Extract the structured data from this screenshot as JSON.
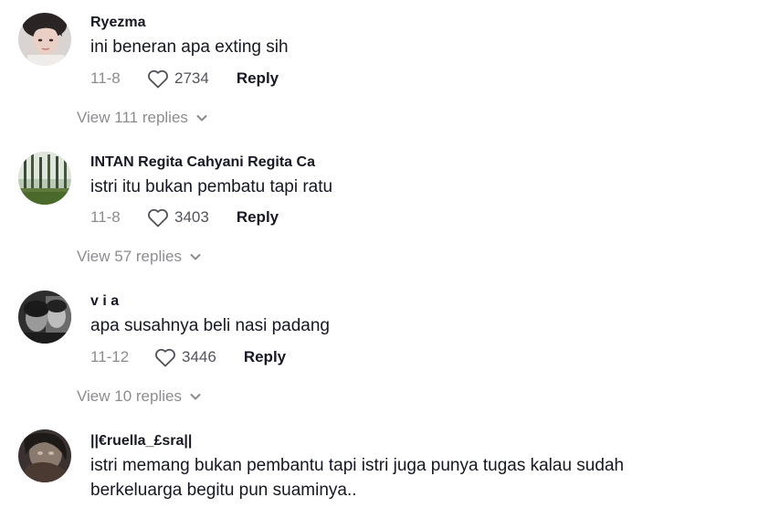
{
  "comments": [
    {
      "username": "Ryezma",
      "text": "ini beneran apa exting sih",
      "date": "11-8",
      "likes": "2734",
      "reply_label": "Reply",
      "view_replies": "View 111 replies"
    },
    {
      "username": "INTAN Regita Cahyani Regita Ca",
      "text": "istri itu bukan pembatu tapi ratu",
      "date": "11-8",
      "likes": "3403",
      "reply_label": "Reply",
      "view_replies": "View 57 replies"
    },
    {
      "username": "v i a",
      "text": "apa susahnya beli nasi padang",
      "date": "11-12",
      "likes": "3446",
      "reply_label": "Reply",
      "view_replies": "View 10 replies"
    },
    {
      "username": "||€ruella_£sra||",
      "text": "istri memang bukan pembantu tapi istri juga punya tugas kalau sudah berkeluarga begitu pun suaminya.."
    }
  ],
  "icons": {
    "like": "heart-outline-icon",
    "expand": "chevron-down-icon"
  },
  "colors": {
    "primary_text": "#161823",
    "secondary_text": "#8a8b91"
  }
}
